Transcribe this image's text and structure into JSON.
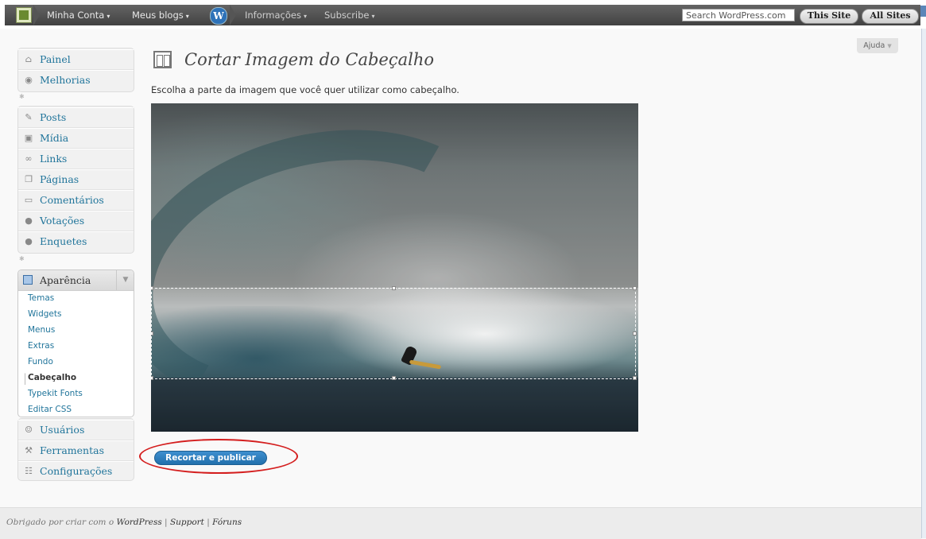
{
  "adminbar": {
    "menus": [
      {
        "label": "Minha Conta",
        "caret": "▾"
      },
      {
        "label": "Meus blogs",
        "caret": "▾"
      },
      {
        "label": "Informações",
        "caret": "▾"
      },
      {
        "label": "Subscribe",
        "caret": "▾"
      }
    ],
    "wp_logo": "W",
    "search_placeholder": "Search WordPress.com",
    "this_site": "This Site",
    "all_sites": "All Sites"
  },
  "sidebar": {
    "top": [
      {
        "label": "Painel",
        "icon": "home-icon",
        "glyph": "⌂"
      },
      {
        "label": "Melhorias",
        "icon": "upgrade-icon",
        "glyph": "◉"
      }
    ],
    "content": [
      {
        "label": "Posts",
        "icon": "pin-icon",
        "glyph": "✎"
      },
      {
        "label": "Mídia",
        "icon": "media-icon",
        "glyph": "▣"
      },
      {
        "label": "Links",
        "icon": "link-icon",
        "glyph": "∞"
      },
      {
        "label": "Páginas",
        "icon": "pages-icon",
        "glyph": "❐"
      },
      {
        "label": "Comentários",
        "icon": "comment-icon",
        "glyph": "▭"
      },
      {
        "label": "Votações",
        "icon": "ratings-icon",
        "glyph": "●"
      },
      {
        "label": "Enquetes",
        "icon": "polls-icon",
        "glyph": "●"
      }
    ],
    "appearance": {
      "label": "Aparência",
      "toggle": "▼",
      "items": [
        "Temas",
        "Widgets",
        "Menus",
        "Extras",
        "Fundo",
        "Cabeçalho",
        "Typekit Fonts",
        "Editar CSS"
      ],
      "current": "Cabeçalho"
    },
    "bottom": [
      {
        "label": "Usuários",
        "icon": "users-icon",
        "glyph": "☺"
      },
      {
        "label": "Ferramentas",
        "icon": "tools-icon",
        "glyph": "⚒"
      },
      {
        "label": "Configurações",
        "icon": "settings-icon",
        "glyph": "☷"
      }
    ],
    "separator": "✱"
  },
  "main": {
    "title": "Cortar Imagem do Cabeçalho",
    "instruction": "Escolha a parte da imagem que você quer utilizar como cabeçalho.",
    "help_tab": "Ajuda",
    "help_caret": "▼",
    "crop_button": "Recortar e publicar"
  },
  "footer": {
    "prefix": "Obrigado por criar com o ",
    "wordpress": "WordPress",
    "sep1": " | ",
    "support": "Support",
    "sep2": " | ",
    "forums": "Fóruns"
  },
  "colors": {
    "link": "#21759b",
    "adminbar": "#464646",
    "button": "#2e81c2",
    "annotation_ring": "#d41e1e"
  }
}
